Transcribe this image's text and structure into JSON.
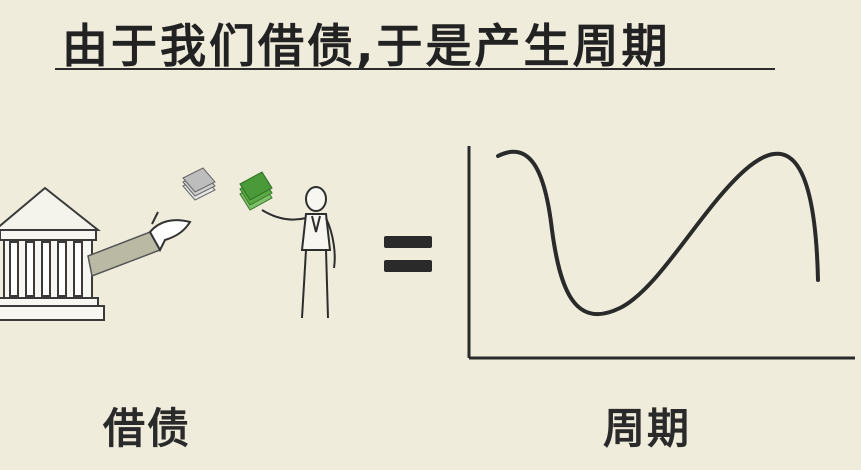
{
  "title": "由于我们借债,于是产生周期",
  "left_label": "借债",
  "right_label": "周期",
  "icons": {
    "bank": "bank-building-icon",
    "cash_gray": "cash-stack-icon",
    "cash_green": "cash-stack-icon",
    "person": "person-figure-icon",
    "equals": "equals-sign-icon",
    "cycle": "cycle-curve-icon"
  },
  "colors": {
    "background": "#efecdc",
    "ink": "#2a2a2a",
    "money_green": "#4a9a3a",
    "money_gray": "#9a9a9a",
    "sleeve": "#b9b9a4"
  }
}
